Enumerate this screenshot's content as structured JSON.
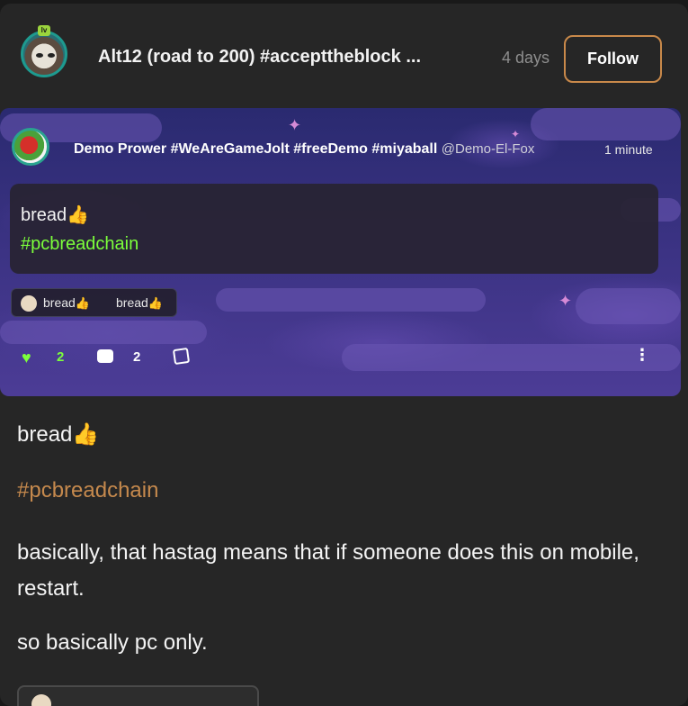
{
  "post": {
    "author_name": "Alt12 (road to 200) #accepttheblock ...",
    "time": "4 days",
    "follow_label": "Follow",
    "avatar_badge": "lv"
  },
  "embed": {
    "author_name": "Demo Prower #WeAreGameJolt #freeDemo #miyaball",
    "handle": "@Demo-El-Fox",
    "time": "1 minute",
    "body_text": "bread",
    "body_emoji": "👍",
    "hashtag": "#pcbreadchain",
    "chip_text_1": "bread",
    "chip_text_2": "bread",
    "chip_emoji": "👍",
    "like_count": "2",
    "comment_count": "2",
    "icons": [
      "heart-icon",
      "comment-icon",
      "share-icon",
      "more-vertical-icon"
    ]
  },
  "content": {
    "line1_text": "bread",
    "line1_emoji": "👍",
    "hashtag": "#pcbreadchain",
    "paragraph": "basically, that hastag means that if someone does this on mobile, restart.",
    "last_line": "so basically pc only."
  },
  "colors": {
    "background": "#262626",
    "follow_border": "#c9894a",
    "hashtag_embed": "#7cff3b",
    "hashtag_post": "#c5894d",
    "like_green": "#7cff3b"
  }
}
